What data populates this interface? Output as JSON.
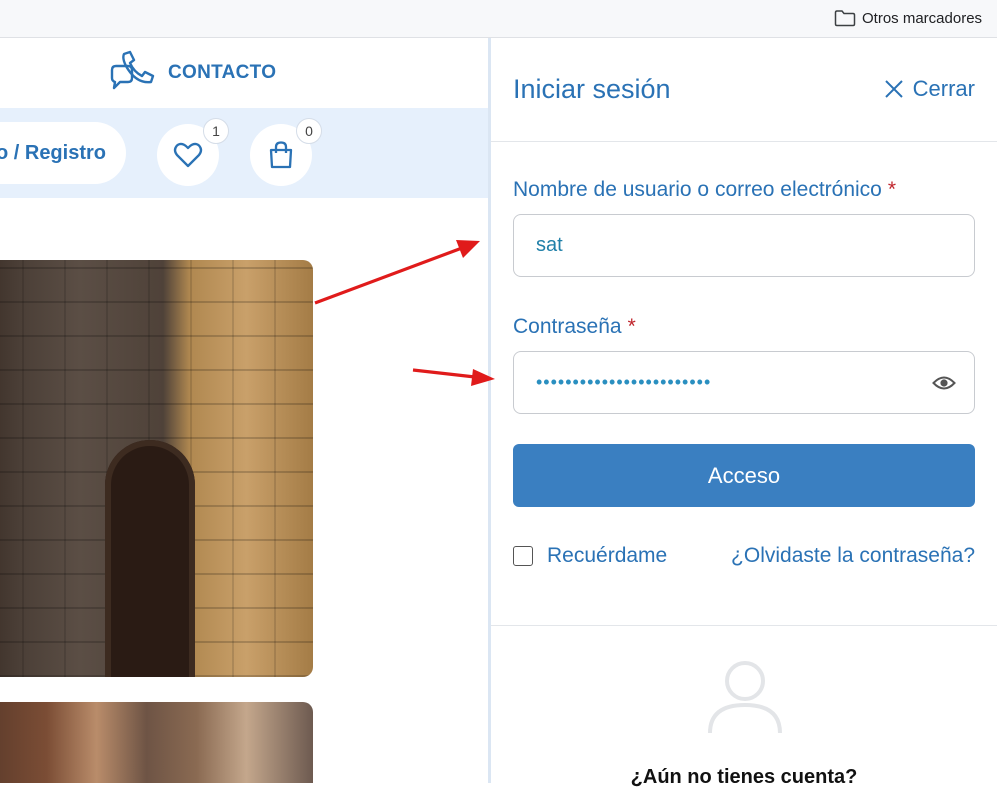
{
  "bookmarks": {
    "other_label": "Otros marcadores",
    "folder_icon": "folder-icon"
  },
  "page": {
    "contact_label": "CONTACTO",
    "login_register_label": "Acceso / Registro",
    "wishlist_count": "1",
    "cart_count": "0"
  },
  "drawer": {
    "title": "Iniciar sesión",
    "close_label": "Cerrar",
    "username_label": "Nombre de usuario o correo electrónico",
    "username_value": "sat",
    "password_label": "Contraseña",
    "password_mask": "••••••••••••••••••••••••",
    "required_marker": "*",
    "submit_label": "Acceso",
    "remember_label": "Recuérdame",
    "forgot_label": "¿Olvidaste la contraseña?",
    "no_account_label": "¿Aún no tienes cuenta?"
  },
  "colors": {
    "accent": "#2a72b5",
    "button": "#3a7fc1",
    "strip": "#e6f0fc",
    "required": "#c0262d",
    "arrow": "#e01b1b"
  }
}
